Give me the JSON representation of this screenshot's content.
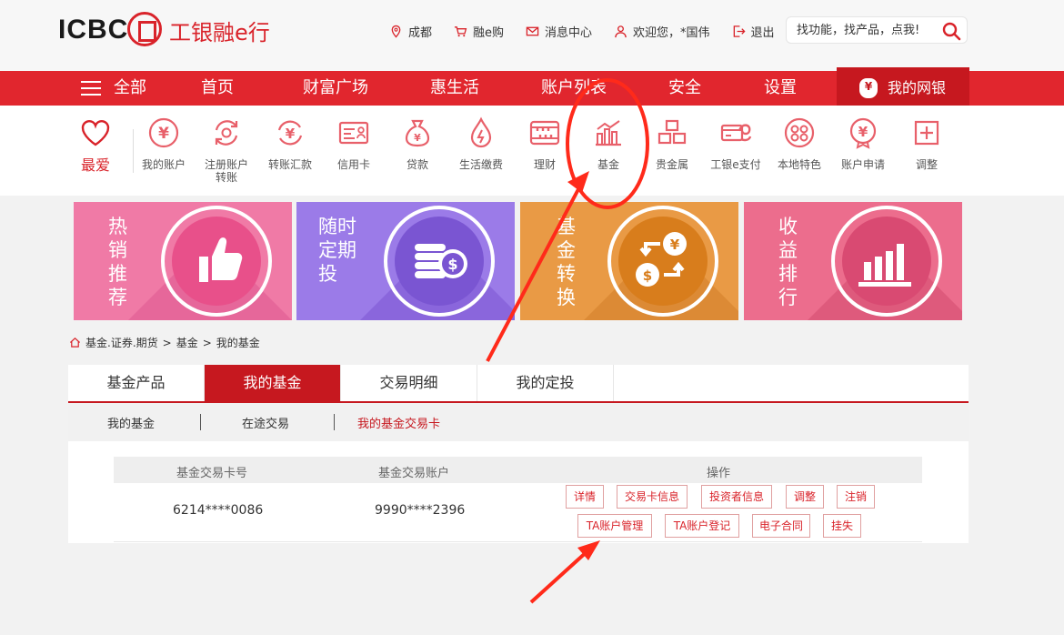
{
  "header": {
    "logo_text": "ICBC",
    "logo_cn": "工银融e行",
    "links": [
      {
        "label": "成都",
        "icon": "location-pin-icon"
      },
      {
        "label": "融e购",
        "icon": "cart-icon"
      },
      {
        "label": "消息中心",
        "icon": "mail-icon"
      },
      {
        "label": "欢迎您，*国伟",
        "icon": "user-icon"
      },
      {
        "label": "退出",
        "icon": "logout-icon"
      }
    ],
    "search_placeholder": "找功能，找产品，点我!"
  },
  "nav": {
    "items": [
      "全部",
      "首页",
      "财富广场",
      "惠生活",
      "账户列表",
      "安全",
      "设置"
    ],
    "mine": "我的网银"
  },
  "quick": {
    "favorite": "最爱",
    "items": [
      {
        "label": "我的账户",
        "icon": "account-icon"
      },
      {
        "label": "注册账户转账",
        "icon": "registered-transfer-icon"
      },
      {
        "label": "转账汇款",
        "icon": "transfer-icon"
      },
      {
        "label": "信用卡",
        "icon": "credit-card-icon"
      },
      {
        "label": "贷款",
        "icon": "loan-icon"
      },
      {
        "label": "生活缴费",
        "icon": "utility-icon"
      },
      {
        "label": "理财",
        "icon": "wealth-icon"
      },
      {
        "label": "基金",
        "icon": "fund-icon"
      },
      {
        "label": "贵金属",
        "icon": "gold-icon"
      },
      {
        "label": "工银e支付",
        "icon": "epay-icon"
      },
      {
        "label": "本地特色",
        "icon": "local-icon"
      },
      {
        "label": "账户申请",
        "icon": "apply-icon"
      },
      {
        "label": "调整",
        "icon": "adjust-icon"
      }
    ]
  },
  "banners": [
    {
      "label": "热销推荐",
      "color": "#f07aa6"
    },
    {
      "label": "随时定期投",
      "color": "#9b7be8"
    },
    {
      "label": "基金转换",
      "color": "#e99a45"
    },
    {
      "label": "收益排行",
      "color": "#ec6d8d"
    }
  ],
  "breadcrumb": [
    "基金.证券.期货",
    "基金",
    "我的基金"
  ],
  "tabs": [
    "基金产品",
    "我的基金",
    "交易明细",
    "我的定投"
  ],
  "active_tab": "我的基金",
  "subtabs": [
    "我的基金",
    "在途交易",
    "我的基金交易卡"
  ],
  "active_subtab": "我的基金交易卡",
  "table": {
    "headers": [
      "基金交易卡号",
      "基金交易账户",
      "操作"
    ],
    "rows": [
      {
        "card": "6214****0086",
        "account": "9990****2396",
        "ops_row1": [
          "详情",
          "交易卡信息",
          "投资者信息",
          "调整",
          "注销"
        ],
        "ops_row2": [
          "TA账户管理",
          "TA账户登记",
          "电子合同",
          "挂失"
        ]
      }
    ]
  },
  "colors": {
    "brand_red": "#e1262e",
    "dark_red": "#c6181f",
    "annotation": "#ff2a1a"
  }
}
